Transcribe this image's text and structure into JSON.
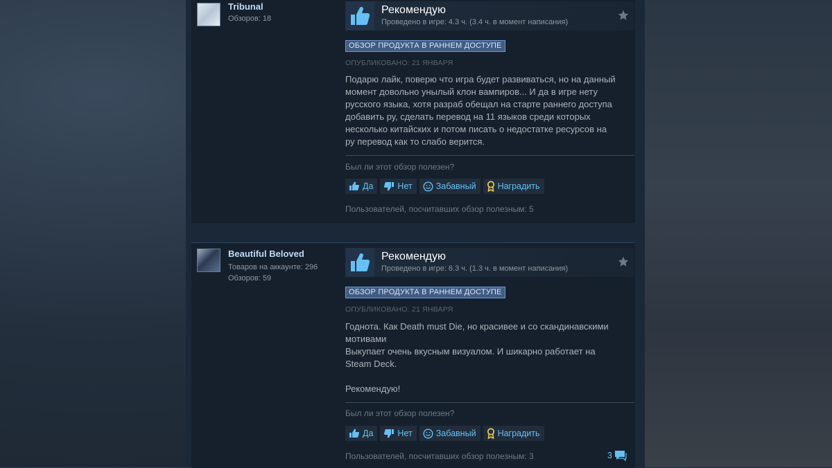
{
  "colors": {
    "accent": "#66c0f4",
    "ea_badge": "#415c83",
    "reward": "#e8c54b"
  },
  "reviews": [
    {
      "user": {
        "name": "Tribunal",
        "stats": [
          "Обзоров: 18"
        ]
      },
      "verdict": "Рекомендую",
      "verdict_icon": "thumbs-up-icon",
      "hours": "Проведено в игре: 4.3 ч. (3.4 ч. в момент написания)",
      "early_access": "ОБЗОР ПРОДУКТА В РАННЕМ ДОСТУПЕ",
      "posted": "ОПУБЛИКОВАНО: 21 ЯНВАРЯ",
      "text": [
        "Подарю лайк, поверю что игра будет развиваться, но на данный",
        "момент довольно унылый клон вампиров... И да в игре нету",
        "русского языка, хотя разраб обещал на старте раннего доступа",
        "добавить ру, сделать перевод на 11 языков среди которых",
        "несколько китайских и потом писать о недостатке ресурсов на",
        "ру перевод как то слабо верится."
      ],
      "question": "Был ли этот обзор полезен?",
      "buttons": {
        "yes": "Да",
        "no": "Нет",
        "funny": "Забавный",
        "award": "Наградить"
      },
      "helpful": "Пользователей, посчитавших обзор полезным: 5"
    },
    {
      "user": {
        "name": "Beautiful Beloved",
        "stats": [
          "Товаров на аккаунте: 296",
          "Обзоров: 59"
        ]
      },
      "verdict": "Рекомендую",
      "verdict_icon": "thumbs-up-icon",
      "hours": "Проведено в игре: 6.3 ч. (1.3 ч. в момент написания)",
      "early_access": "ОБЗОР ПРОДУКТА В РАННЕМ ДОСТУПЕ",
      "posted": "ОПУБЛИКОВАНО: 21 ЯНВАРЯ",
      "text": [
        "Годнота. Как Death must Die, но красивее и со скандинавскими",
        "мотивами",
        "Выкупает очень вкусным визуалом. И шикарно работает на",
        "Steam Deck.",
        "",
        "Рекомендую!"
      ],
      "question": "Был ли этот обзор полезен?",
      "buttons": {
        "yes": "Да",
        "no": "Нет",
        "funny": "Забавный",
        "award": "Наградить"
      },
      "helpful": "Пользователей, посчитавших обзор полезным: 3",
      "comments": "3"
    }
  ]
}
